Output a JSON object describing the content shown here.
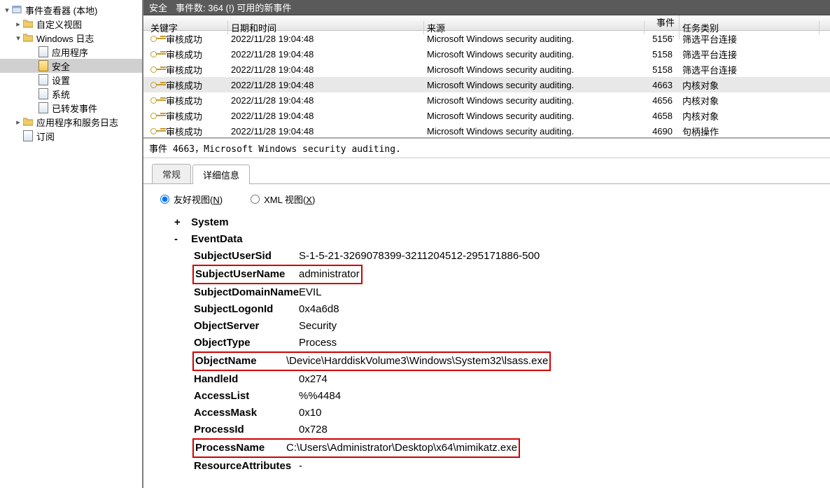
{
  "tree": {
    "root": "事件查看器 (本地)",
    "custom_views": "自定义视图",
    "windows_logs": "Windows 日志",
    "logs": [
      {
        "label": "应用程序"
      },
      {
        "label": "安全",
        "selected": true
      },
      {
        "label": "设置"
      },
      {
        "label": "系统"
      },
      {
        "label": "已转发事件"
      }
    ],
    "app_service_logs": "应用程序和服务日志",
    "subscriptions": "订阅"
  },
  "header": {
    "title": "安全",
    "count_label": "事件数: 364 (!) 可用的新事件"
  },
  "columns": {
    "keyword": "关键字",
    "datetime": "日期和时间",
    "source": "来源",
    "eventid": "事件 ...",
    "category": "任务类别"
  },
  "events": [
    {
      "keyword": "审核成功",
      "datetime": "2022/11/28 19:04:48",
      "source": "Microsoft Windows security auditing.",
      "id": "5156",
      "category": "筛选平台连接"
    },
    {
      "keyword": "审核成功",
      "datetime": "2022/11/28 19:04:48",
      "source": "Microsoft Windows security auditing.",
      "id": "5158",
      "category": "筛选平台连接"
    },
    {
      "keyword": "审核成功",
      "datetime": "2022/11/28 19:04:48",
      "source": "Microsoft Windows security auditing.",
      "id": "5158",
      "category": "筛选平台连接"
    },
    {
      "keyword": "审核成功",
      "datetime": "2022/11/28 19:04:48",
      "source": "Microsoft Windows security auditing.",
      "id": "4663",
      "category": "内核对象",
      "selected": true
    },
    {
      "keyword": "审核成功",
      "datetime": "2022/11/28 19:04:48",
      "source": "Microsoft Windows security auditing.",
      "id": "4656",
      "category": "内核对象"
    },
    {
      "keyword": "审核成功",
      "datetime": "2022/11/28 19:04:48",
      "source": "Microsoft Windows security auditing.",
      "id": "4658",
      "category": "内核对象"
    },
    {
      "keyword": "审核成功",
      "datetime": "2022/11/28 19:04:48",
      "source": "Microsoft Windows security auditing.",
      "id": "4690",
      "category": "句柄操作"
    }
  ],
  "detail": {
    "title": "事件 4663，Microsoft Windows security auditing.",
    "tabs": {
      "general": "常规",
      "details": "详细信息"
    },
    "radio": {
      "friendly_prefix": "友好视图(",
      "friendly_key": "N",
      "friendly_suffix": ")",
      "xml_prefix": "XML 视图(",
      "xml_key": "X",
      "xml_suffix": ")"
    },
    "system_label": "System",
    "eventdata_label": "EventData",
    "fields": [
      {
        "k": "SubjectUserSid",
        "v": "S-1-5-21-3269078399-3211204512-295171886-500"
      },
      {
        "k": "SubjectUserName",
        "v": "administrator",
        "hl": true
      },
      {
        "k": "SubjectDomainName",
        "v": "EVIL"
      },
      {
        "k": "SubjectLogonId",
        "v": "0x4a6d8"
      },
      {
        "k": "ObjectServer",
        "v": "Security"
      },
      {
        "k": "ObjectType",
        "v": "Process"
      },
      {
        "k": "ObjectName",
        "v": "\\Device\\HarddiskVolume3\\Windows\\System32\\lsass.exe",
        "hl": true,
        "wide": true
      },
      {
        "k": "HandleId",
        "v": "0x274"
      },
      {
        "k": "AccessList",
        "v": "%%4484"
      },
      {
        "k": "AccessMask",
        "v": "0x10"
      },
      {
        "k": "ProcessId",
        "v": "0x728"
      },
      {
        "k": "ProcessName",
        "v": "C:\\Users\\Administrator\\Desktop\\x64\\mimikatz.exe",
        "hl": true,
        "wide": true
      },
      {
        "k": "ResourceAttributes",
        "v": "-"
      }
    ]
  }
}
